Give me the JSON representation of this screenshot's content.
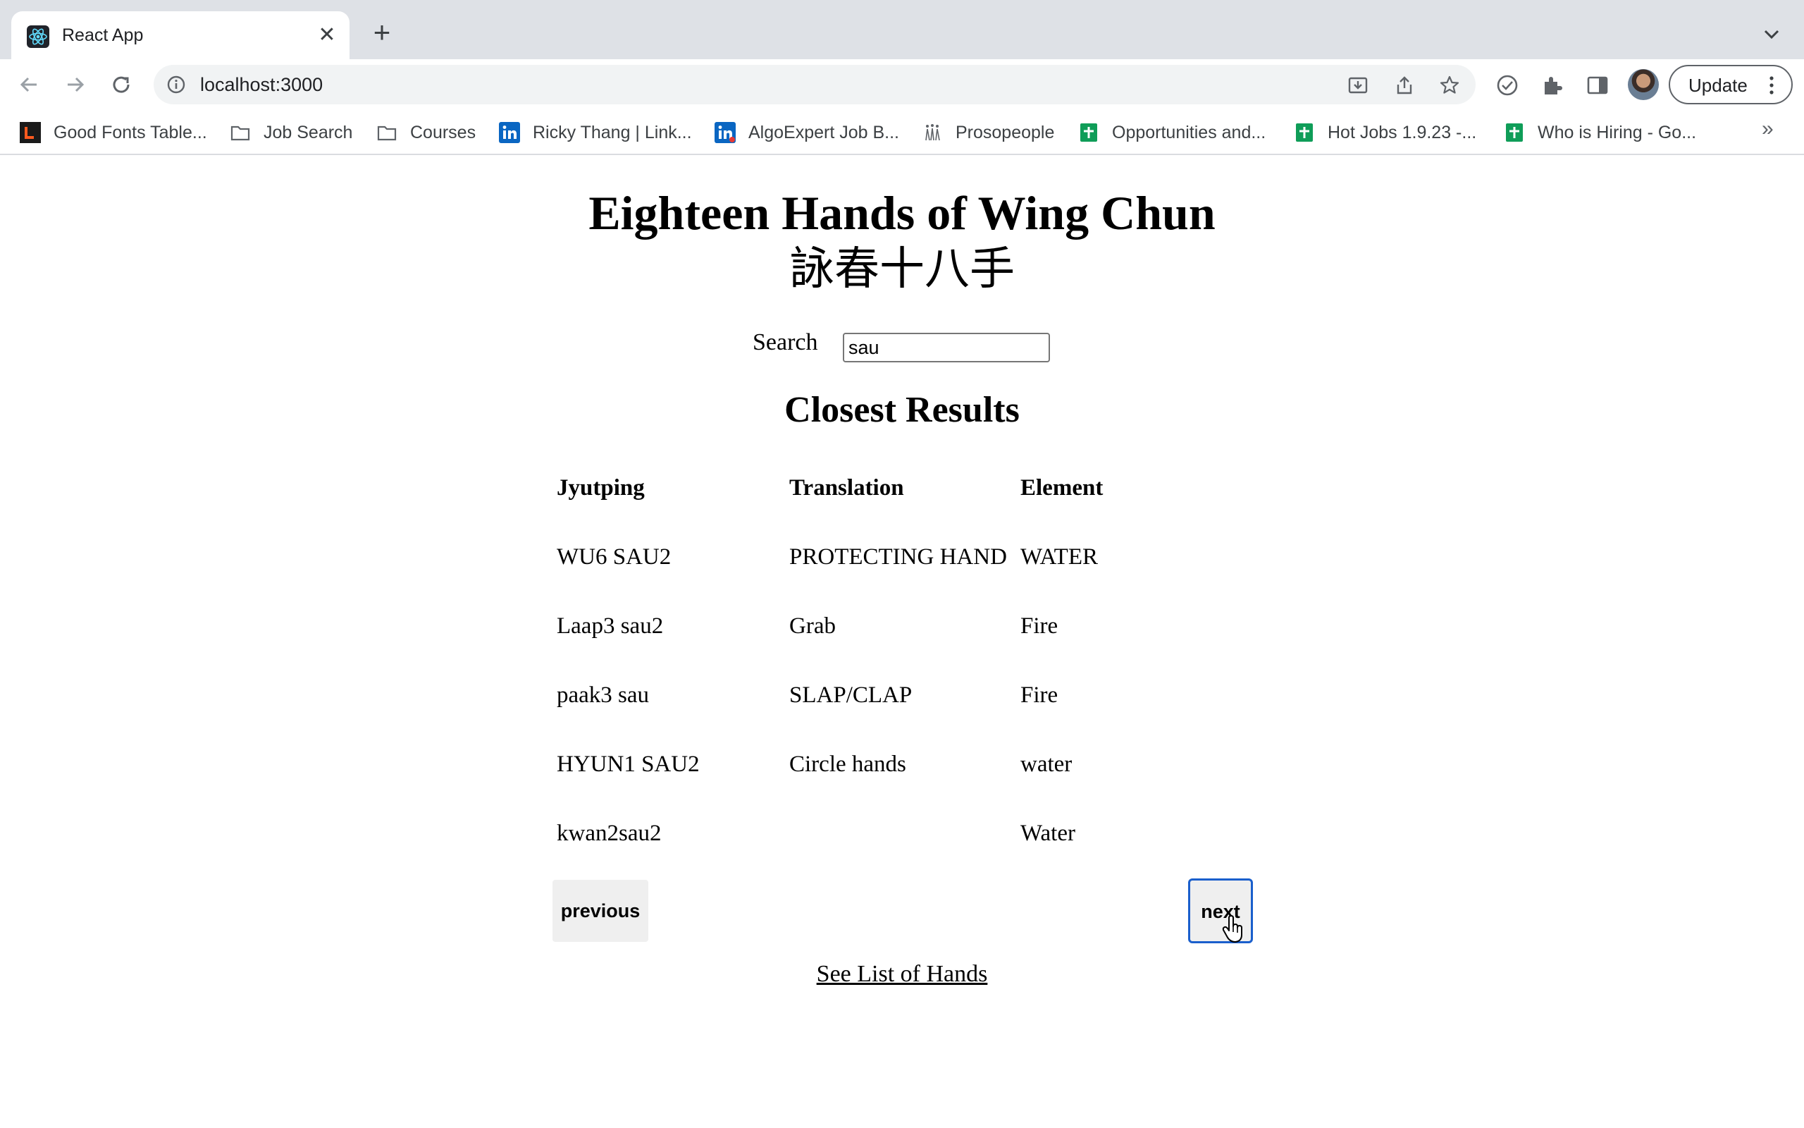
{
  "browser": {
    "tab_title": "React App",
    "url": "localhost:3000",
    "update_label": "Update",
    "bookmarks": [
      {
        "label": "Good Fonts Table...",
        "icon": "fonts-favicon-icon"
      },
      {
        "label": "Job Search",
        "icon": "folder-icon"
      },
      {
        "label": "Courses",
        "icon": "folder-icon"
      },
      {
        "label": "Ricky Thang | Link...",
        "icon": "linkedin-icon"
      },
      {
        "label": "AlgoExpert Job B...",
        "icon": "linkedin-icon"
      },
      {
        "label": "Prosopeople",
        "icon": "prosopeople-icon"
      },
      {
        "label": "Opportunities and...",
        "icon": "sheets-icon"
      },
      {
        "label": "Hot Jobs 1.9.23 -...",
        "icon": "sheets-icon"
      },
      {
        "label": "Who is Hiring - Go...",
        "icon": "sheets-icon"
      }
    ],
    "bookmarks_overflow": "»"
  },
  "page": {
    "title": "Eighteen Hands of Wing Chun",
    "subtitle": "詠春十八手",
    "search_label": "Search",
    "search_value": "sau",
    "results_heading": "Closest Results",
    "columns": [
      "Jyutping",
      "Translation",
      "Element"
    ],
    "rows": [
      [
        "WU6 SAU2",
        "PROTECTING HAND",
        "WATER"
      ],
      [
        "Laap3 sau2",
        "Grab",
        "Fire"
      ],
      [
        "paak3 sau",
        "SLAP/CLAP",
        "Fire"
      ],
      [
        "HYUN1 SAU2",
        "Circle hands",
        "water"
      ],
      [
        "kwan2sau2",
        "",
        "Water"
      ]
    ],
    "previous_label": "previous",
    "next_label": "next",
    "hands_link": "See List of Hands"
  }
}
